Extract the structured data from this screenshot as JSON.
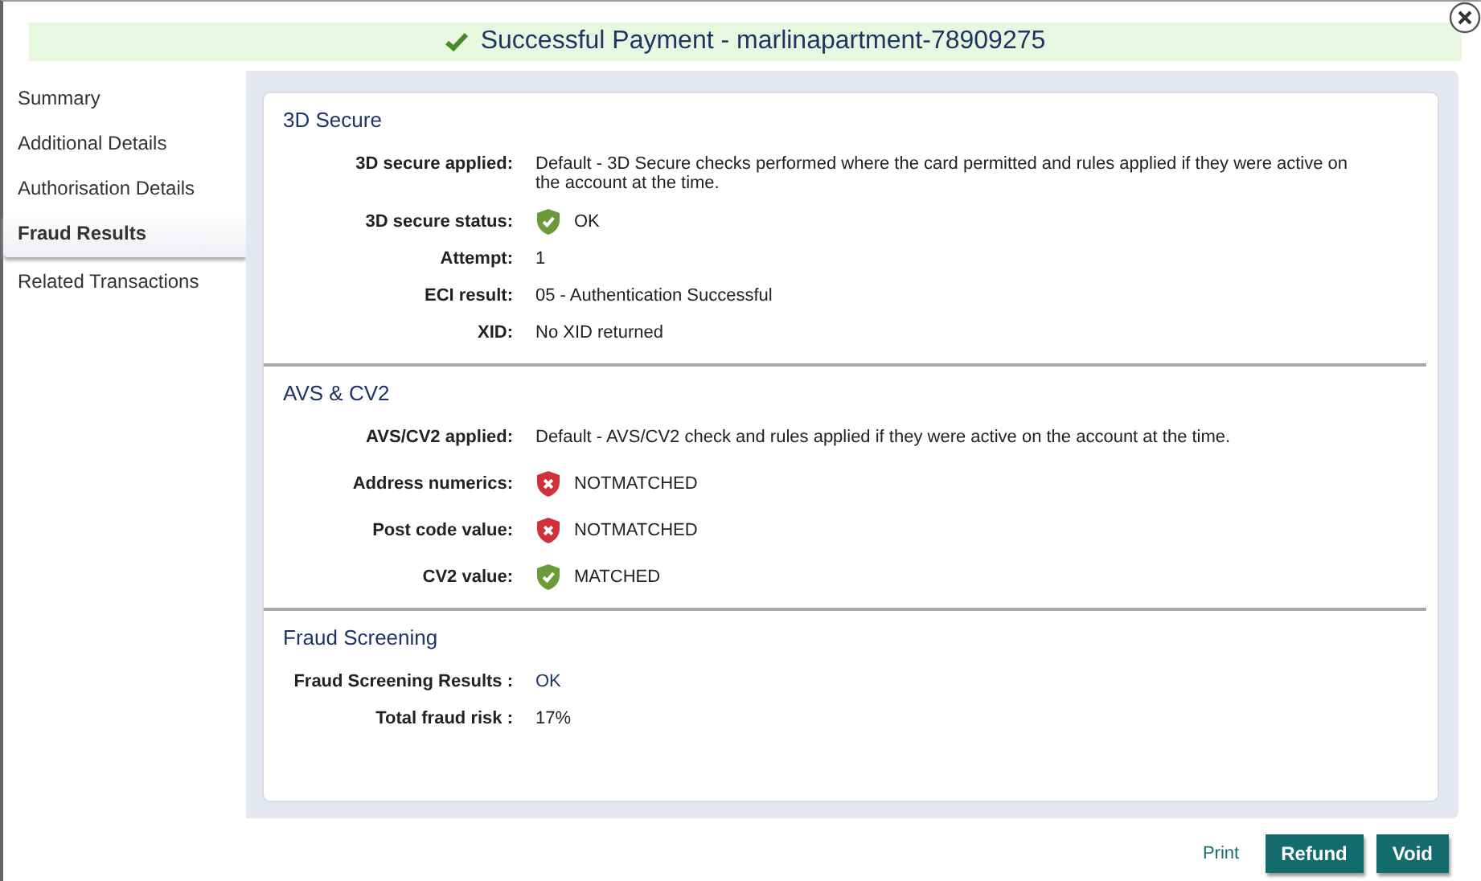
{
  "title": "Successful Payment - marlinapartment-78909275",
  "sidebar": [
    {
      "label": "Summary",
      "selected": false
    },
    {
      "label": "Additional Details",
      "selected": false
    },
    {
      "label": "Authorisation Details",
      "selected": false
    },
    {
      "label": "Fraud Results",
      "selected": true
    },
    {
      "label": "Related Transactions",
      "selected": false
    }
  ],
  "sections": [
    {
      "heading": "3D Secure",
      "rows": [
        {
          "kind": "text",
          "label": "3D secure applied:",
          "value": "Default - 3D Secure checks performed where the card permitted and rules applied if they were active on the account at the time."
        },
        {
          "kind": "status",
          "passed": true,
          "label": "3D secure status:",
          "value": "OK"
        },
        {
          "kind": "text",
          "label": "Attempt:",
          "value": "1"
        },
        {
          "kind": "text",
          "label": "ECI result:",
          "value": "05 - Authentication Successful"
        },
        {
          "kind": "text",
          "label": "XID:",
          "value": "No XID returned"
        }
      ]
    },
    {
      "heading": "AVS & CV2",
      "rows": [
        {
          "kind": "text",
          "label": "AVS/CV2 applied:",
          "value": "Default - AVS/CV2 check and rules applied if they were active on the account at the time."
        },
        {
          "kind": "status",
          "passed": false,
          "label": "Address numerics:",
          "value": "NOTMATCHED"
        },
        {
          "kind": "status",
          "passed": false,
          "label": "Post code value:",
          "value": "NOTMATCHED"
        },
        {
          "kind": "status",
          "passed": true,
          "label": "CV2 value:",
          "value": "MATCHED"
        }
      ]
    },
    {
      "heading": "Fraud Screening",
      "rows": [
        {
          "kind": "link",
          "label": "Fraud Screening Results :",
          "value": "OK"
        },
        {
          "kind": "text",
          "label": "Total fraud risk :",
          "value": "17%"
        }
      ]
    }
  ],
  "actions": {
    "print": "Print",
    "buttons": [
      "Refund",
      "Void"
    ]
  }
}
